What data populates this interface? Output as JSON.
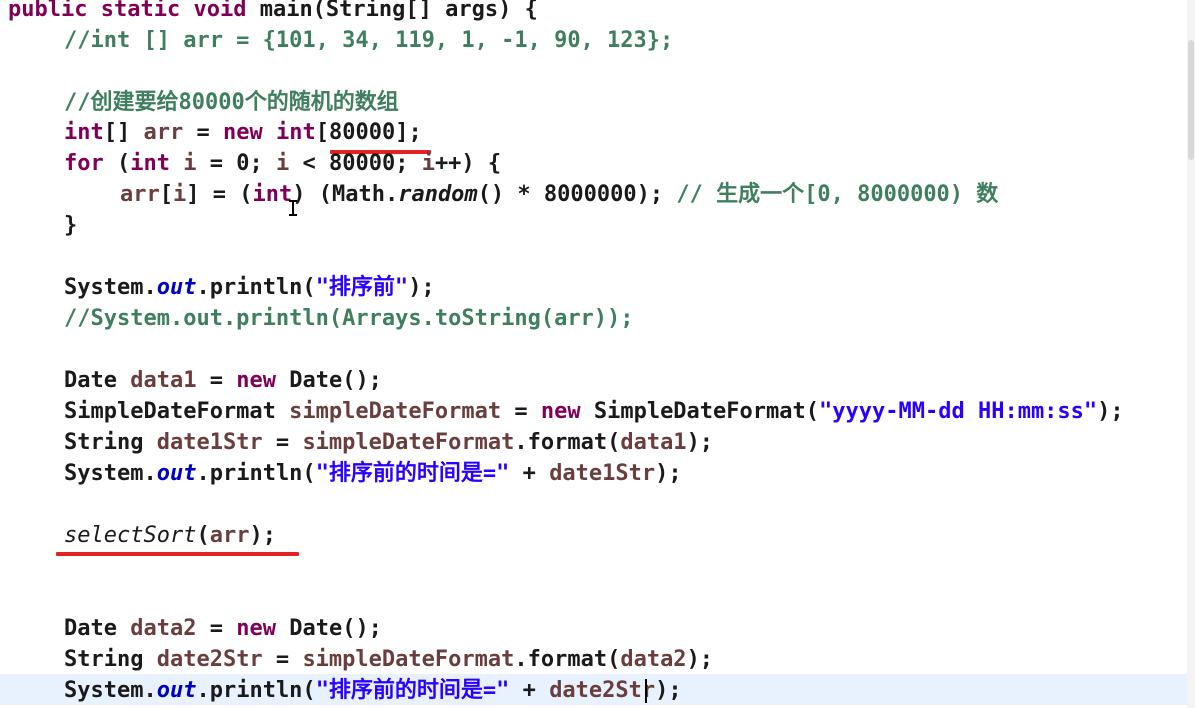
{
  "code": {
    "method_sig": "main(String[] args) {",
    "kw_public": "public",
    "kw_static": "static",
    "kw_void": "void",
    "commented_init": "//int [] arr = {101, 34, 119, 1, -1, 90, 123};",
    "comment_create": "//创建要给80000个的随机的数组",
    "size_literal": "[80000]",
    "random_comment": "// 生成一个[0, 8000000) 数",
    "before_sort_str": "\"排序前\"",
    "commented_print": "//System.out.println(Arrays.toString(arr));",
    "date_pattern": "\"yyyy-MM-dd HH:mm:ss\"",
    "time_before_str": "\"排序前的时间是=\"",
    "sort_call": "selectSort",
    "closing_brace": "}"
  },
  "colors": {
    "keyword": "#7f0055",
    "comment": "#3f7f5f",
    "string": "#2a00ff",
    "local_variable": "#6a3e3e",
    "static_field": "#0000c0",
    "annotation_underline": "#e52222",
    "current_line": "#e8f2fe"
  }
}
